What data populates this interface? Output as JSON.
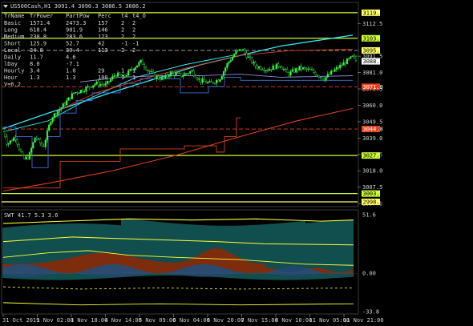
{
  "window": {
    "title": "US500Cash,H1  3091.4 3090.3 3086.5 3086.2"
  },
  "stats_table": {
    "headers": [
      "TrName",
      "TrPower",
      "PartPow",
      "Perc",
      "t4",
      "t4_O"
    ],
    "rows": [
      [
        "Basic",
        "1571.4",
        "2473.3",
        "157",
        "2",
        "2"
      ],
      [
        "Long",
        "618.4",
        "901.9",
        "146",
        "2",
        "2"
      ],
      [
        "Medium",
        "230.8",
        "283.6",
        "123",
        "2",
        "2"
      ],
      [
        "Short",
        "125.9",
        "52.7",
        "42",
        "-1",
        "-1"
      ],
      [
        "Local",
        "34.8",
        "39.4",
        "113",
        "2",
        "2"
      ],
      [
        "Daily",
        "11.7",
        "4.6",
        "",
        "",
        ""
      ],
      [
        "lDay",
        "8.0",
        "-7.1",
        "",
        "",
        ""
      ],
      [
        "Hourly",
        "3.4",
        "1.0",
        "29",
        "1",
        "1"
      ],
      [
        "Hour",
        "1.3",
        "1.3",
        "100",
        "1",
        "1"
      ]
    ],
    "footer": "V=6.2"
  },
  "price_axis": {
    "ticks": [
      "3112.5",
      "3091.5",
      "3081.0",
      "3070.5",
      "3060.0",
      "3049.5",
      "3039.0",
      "3028.5",
      "3018.0",
      "3007.5",
      "2997.0"
    ],
    "range": [
      2995,
      3126
    ]
  },
  "level_tags": [
    {
      "label": "3119.4",
      "price": 3119.4,
      "color": "#ffff66",
      "text_color": "#000000",
      "line": "solid",
      "line_color": "#ccff33"
    },
    {
      "label": "3103.0",
      "price": 3103.0,
      "color": "#ccff33",
      "text_color": "#000000",
      "line": "solid",
      "line_color": "#ccff33"
    },
    {
      "label": "3095.2",
      "price": 3095.2,
      "color": "#ffff66",
      "text_color": "#000000",
      "line": "dashed",
      "line_color": "#b4b4b4"
    },
    {
      "label": "3088.2",
      "price": 3088.2,
      "color": "#ffffff",
      "text_color": "#000000",
      "line": "none",
      "line_color": ""
    },
    {
      "label": "3071.9",
      "price": 3071.9,
      "color": "#e8421c",
      "text_color": "#ffffff",
      "line": "dashed",
      "line_color": "#e8421c"
    },
    {
      "label": "3044.8",
      "price": 3044.8,
      "color": "#e8421c",
      "text_color": "#ffffff",
      "line": "dashed",
      "line_color": "#e8421c"
    },
    {
      "label": "3027.8",
      "price": 3027.8,
      "color": "#ccff33",
      "text_color": "#000000",
      "line": "solid",
      "line_color": "#ccff33"
    },
    {
      "label": "3003.4",
      "price": 3003.4,
      "color": "#ccff33",
      "text_color": "#000000",
      "line": "solid",
      "line_color": "#ccff33"
    },
    {
      "label": "2998.1",
      "price": 2998.1,
      "color": "#ffff66",
      "text_color": "#000000",
      "line": "solid",
      "line_color": "#ffff66"
    }
  ],
  "indicator": {
    "title": "SWT 41.7 5.3 3.6",
    "ticks": [
      "51.6",
      "0.00",
      "-33.8"
    ],
    "range": [
      -36,
      56
    ]
  },
  "time_axis": {
    "labels": [
      "31 Oct 2019",
      "1 Nov 02:00",
      "1 Nov 18:00",
      "4 Nov 14:00",
      "5 Nov 09:00",
      "6 Nov 04:00",
      "6 Nov 20:00",
      "7 Nov 15:00",
      "8 Nov 10:00",
      "11 Nov 05:00",
      "11 Nov 21:00"
    ]
  },
  "chart_data": {
    "type": "line",
    "main_series": {
      "name": "US500Cash,H1",
      "x_labels": [
        "31 Oct 2019",
        "1 Nov 02:00",
        "1 Nov 18:00",
        "4 Nov 14:00",
        "5 Nov 09:00",
        "6 Nov 04:00",
        "6 Nov 20:00",
        "7 Nov 15:00",
        "8 Nov 10:00",
        "11 Nov 05:00",
        "11 Nov 21:00"
      ],
      "close": [
        3045,
        3025,
        3047,
        3075,
        3085,
        3080,
        3077,
        3090,
        3084,
        3076,
        3084,
        3090
      ],
      "keypoints": [
        [
          0,
          3045
        ],
        [
          5,
          3035
        ],
        [
          15,
          3040
        ],
        [
          25,
          3025
        ],
        [
          32,
          3027
        ],
        [
          40,
          3040
        ],
        [
          50,
          3033
        ],
        [
          60,
          3052
        ],
        [
          75,
          3060
        ],
        [
          88,
          3068
        ],
        [
          100,
          3070
        ],
        [
          115,
          3074
        ],
        [
          128,
          3073
        ],
        [
          140,
          3080
        ],
        [
          150,
          3078
        ],
        [
          160,
          3083
        ],
        [
          172,
          3088
        ],
        [
          180,
          3083
        ],
        [
          190,
          3078
        ],
        [
          200,
          3077
        ],
        [
          210,
          3081
        ],
        [
          222,
          3079
        ],
        [
          235,
          3082
        ],
        [
          245,
          3076
        ],
        [
          258,
          3074
        ],
        [
          270,
          3077
        ],
        [
          280,
          3087
        ],
        [
          290,
          3094
        ],
        [
          298,
          3096
        ],
        [
          305,
          3091
        ],
        [
          315,
          3085
        ],
        [
          330,
          3083
        ],
        [
          345,
          3086
        ],
        [
          355,
          3080
        ],
        [
          370,
          3084
        ],
        [
          385,
          3082
        ],
        [
          400,
          3077
        ],
        [
          412,
          3082
        ],
        [
          425,
          3087
        ],
        [
          436,
          3091
        ],
        [
          442,
          3088
        ]
      ]
    },
    "ylim": [
      2995,
      3126
    ],
    "indicator": {
      "name": "SWT",
      "ylim": [
        -36,
        56
      ]
    }
  }
}
